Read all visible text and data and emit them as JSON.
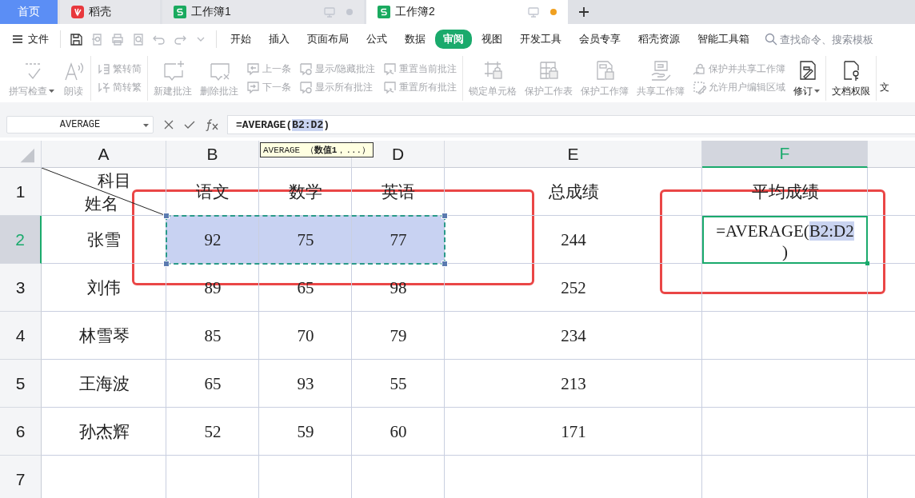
{
  "tabs": [
    {
      "label": "首页",
      "kind": "home",
      "selected": false
    },
    {
      "label": "稻壳",
      "kind": "app",
      "selected": false
    },
    {
      "label": "工作簿1",
      "kind": "doc",
      "selected": false,
      "unsaved": false
    },
    {
      "label": "工作簿2",
      "kind": "doc",
      "selected": true,
      "unsaved": true
    }
  ],
  "menu": {
    "file": "文件",
    "tabs": [
      {
        "label": "开始",
        "selected": false
      },
      {
        "label": "插入",
        "selected": false
      },
      {
        "label": "页面布局",
        "selected": false
      },
      {
        "label": "公式",
        "selected": false
      },
      {
        "label": "数据",
        "selected": false
      },
      {
        "label": "审阅",
        "selected": true
      },
      {
        "label": "视图",
        "selected": false
      },
      {
        "label": "开发工具",
        "selected": false
      },
      {
        "label": "会员专享",
        "selected": false
      },
      {
        "label": "稻壳资源",
        "selected": false
      },
      {
        "label": "智能工具箱",
        "selected": false
      }
    ],
    "search": {
      "placeholder": "查找命令、搜索模板"
    }
  },
  "ribbon": [
    [
      {
        "kind": "large",
        "label": "拼写检查",
        "dropdown": true,
        "disabled": true
      },
      {
        "kind": "large",
        "label": "朗读",
        "disabled": true
      }
    ],
    [
      {
        "kind": "stack",
        "items": [
          {
            "label": "繁转简",
            "disabled": true
          },
          {
            "label": "简转繁",
            "disabled": true
          }
        ]
      }
    ],
    [
      {
        "kind": "large",
        "label": "新建批注",
        "disabled": true
      },
      {
        "kind": "large",
        "label": "删除批注",
        "disabled": true
      },
      {
        "kind": "stack",
        "items": [
          {
            "label": "上一条",
            "disabled": true
          },
          {
            "label": "下一条",
            "disabled": true
          }
        ]
      },
      {
        "kind": "stack",
        "items": [
          {
            "label": "显示/隐藏批注",
            "disabled": true
          },
          {
            "label": "显示所有批注",
            "disabled": true
          }
        ]
      },
      {
        "kind": "stack",
        "items": [
          {
            "label": "重置当前批注",
            "disabled": true
          },
          {
            "label": "重置所有批注",
            "disabled": true
          }
        ]
      }
    ],
    [
      {
        "kind": "large",
        "label": "锁定单元格",
        "disabled": true
      },
      {
        "kind": "large",
        "label": "保护工作表",
        "disabled": true
      },
      {
        "kind": "large",
        "label": "保护工作簿",
        "disabled": true
      },
      {
        "kind": "large",
        "label": "共享工作簿",
        "disabled": true
      },
      {
        "kind": "stack",
        "items": [
          {
            "label": "保护并共享工作簿",
            "disabled": true
          },
          {
            "label": "允许用户编辑区域",
            "disabled": true
          }
        ]
      },
      {
        "kind": "large",
        "label": "修订",
        "dropdown": true,
        "disabled": false
      }
    ],
    [
      {
        "kind": "large",
        "label": "文档权限",
        "disabled": false
      }
    ],
    [
      {
        "kind": "cut",
        "label": "文"
      }
    ]
  ],
  "formula_bar": {
    "name_box": "AVERAGE",
    "formula": {
      "prefix": "=AVERAGE(",
      "ref": "B2:D2",
      "suffix": ")"
    }
  },
  "tooltip": "AVERAGE （**数值1**，...）",
  "sheet": {
    "columns": [
      {
        "label": "A",
        "selected": false
      },
      {
        "label": "B",
        "selected": false
      },
      {
        "selected": false
      },
      {
        "label": "D",
        "selected": false
      },
      {
        "label": "E",
        "selected": false
      },
      {
        "label": "F",
        "selected": true
      },
      {
        "selected": false
      }
    ],
    "rows": [
      {
        "label": "1",
        "selected": false,
        "cells": [
          {
            "kind": "diagonal",
            "top": "科目",
            "bottom": "姓名"
          },
          {
            "text": "语文",
            "selected": false
          },
          {
            "text": "数学",
            "selected": false
          },
          {
            "text": "英语",
            "selected": false
          },
          {
            "text": "总成绩",
            "selected": false
          },
          {
            "text": "平均成绩",
            "selected": false
          },
          {}
        ]
      },
      {
        "label": "2",
        "selected": true,
        "cells": [
          {
            "text": "张雪",
            "selected": false
          },
          {
            "text": "92",
            "selected": true
          },
          {
            "text": "75",
            "selected": true
          },
          {
            "text": "77",
            "selected": true
          },
          {
            "text": "244",
            "selected": false
          },
          {
            "kind": "editing",
            "prefix": "=AVERAGE(",
            "ref": "B2:D2",
            "suffix": ")"
          },
          {}
        ]
      },
      {
        "label": "3",
        "selected": false,
        "cells": [
          {
            "text": "刘伟",
            "selected": false
          },
          {
            "text": "89",
            "selected": false
          },
          {
            "text": "65",
            "selected": false
          },
          {
            "text": "98",
            "selected": false
          },
          {
            "text": "252",
            "selected": false
          },
          {},
          {}
        ]
      },
      {
        "label": "4",
        "selected": false,
        "cells": [
          {
            "text": "林雪琴",
            "selected": false
          },
          {
            "text": "85",
            "selected": false
          },
          {
            "text": "70",
            "selected": false
          },
          {
            "text": "79",
            "selected": false
          },
          {
            "text": "234",
            "selected": false
          },
          {},
          {}
        ]
      },
      {
        "label": "5",
        "selected": false,
        "cells": [
          {
            "text": "王海波",
            "selected": false
          },
          {
            "text": "65",
            "selected": false
          },
          {
            "text": "93",
            "selected": false
          },
          {
            "text": "55",
            "selected": false
          },
          {
            "text": "213",
            "selected": false
          },
          {},
          {}
        ]
      },
      {
        "label": "6",
        "selected": false,
        "cells": [
          {
            "text": "孙杰辉",
            "selected": false
          },
          {
            "text": "52",
            "selected": false
          },
          {
            "text": "59",
            "selected": false
          },
          {
            "text": "60",
            "selected": false
          },
          {
            "text": "171",
            "selected": false
          },
          {},
          {}
        ]
      },
      {
        "label": "7",
        "selected": false,
        "cells": [
          {},
          {},
          {},
          {},
          {},
          {},
          {}
        ]
      }
    ]
  },
  "annotation_boxes": [
    {
      "kind": "rect"
    },
    {
      "kind": "rect"
    }
  ]
}
